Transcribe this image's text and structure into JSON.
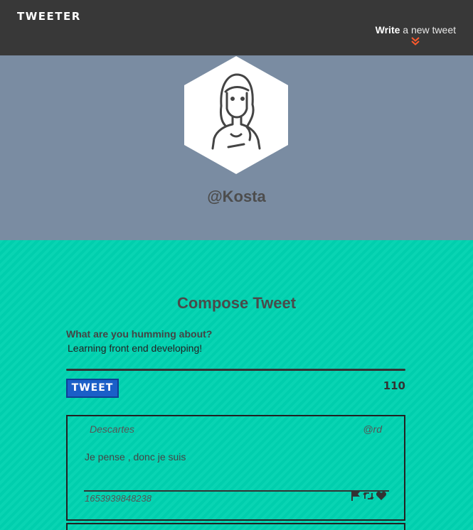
{
  "nav": {
    "brand": "Tweeter",
    "write_bold": "Write",
    "write_rest": " a new tweet",
    "chevron_icon": "double-chevron-down-icon",
    "chevron_color": "#ff5a2c"
  },
  "profile": {
    "avatar_icon": "girl-avatar-icon",
    "handle": "@Kosta"
  },
  "compose": {
    "title": "Compose Tweet",
    "prompt": "What are you humming about?",
    "text": "Learning front end developing!",
    "button_label": "TWEET",
    "counter": "110"
  },
  "tweets": [
    {
      "author": "Descartes",
      "handle": "@rd",
      "body": "Je pense , donc je suis",
      "timestamp": "1653939848238"
    }
  ],
  "colors": {
    "nav_bg": "#383838",
    "profile_bg": "#7a8ca2",
    "compose_bg": "#00d2b0",
    "button_bg": "#1a5fc8"
  }
}
